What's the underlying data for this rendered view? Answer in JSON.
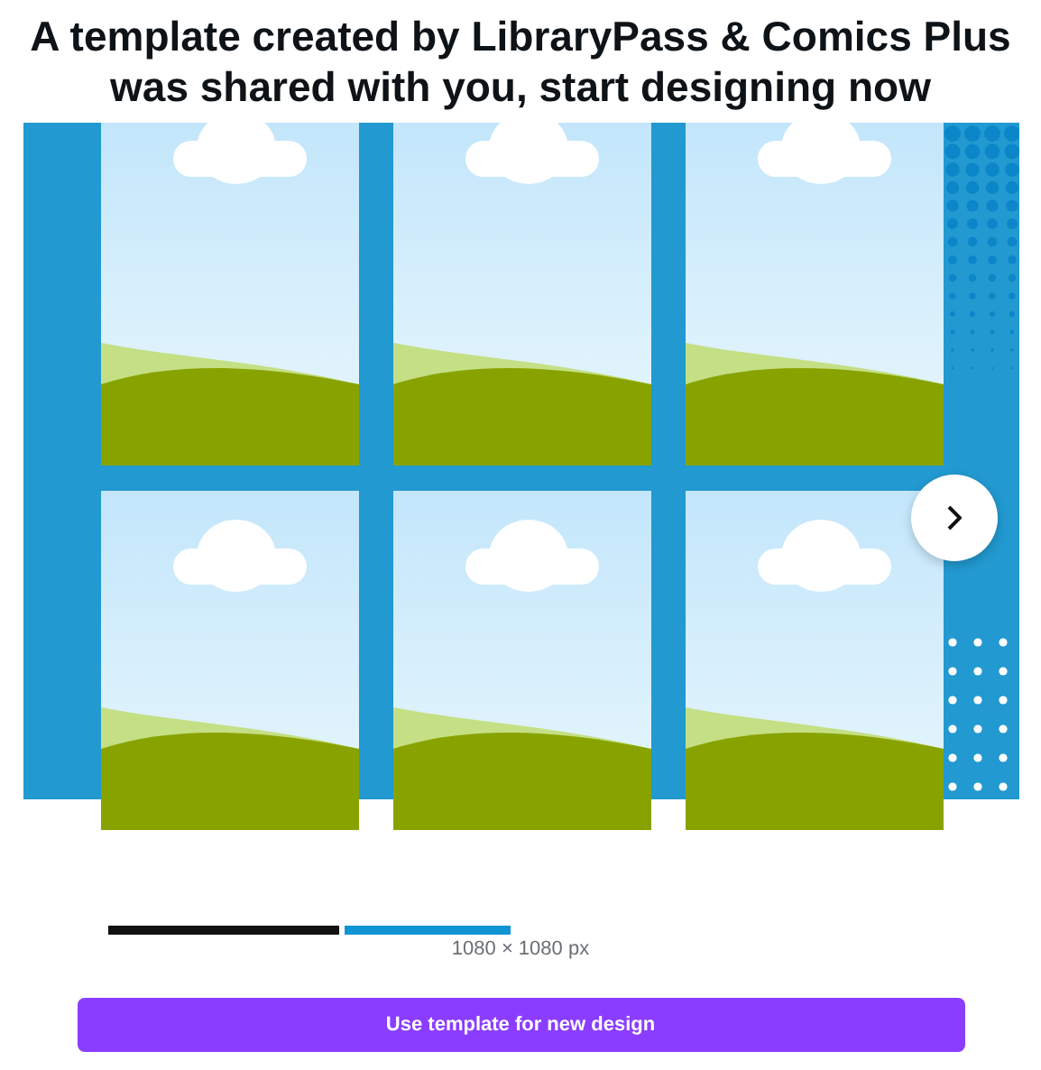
{
  "title": "A template created by LibraryPass & Comics Plus was shared with you, start designing now",
  "dimensions": "1080 × 1080 px",
  "primary_button": "Use template for new design"
}
